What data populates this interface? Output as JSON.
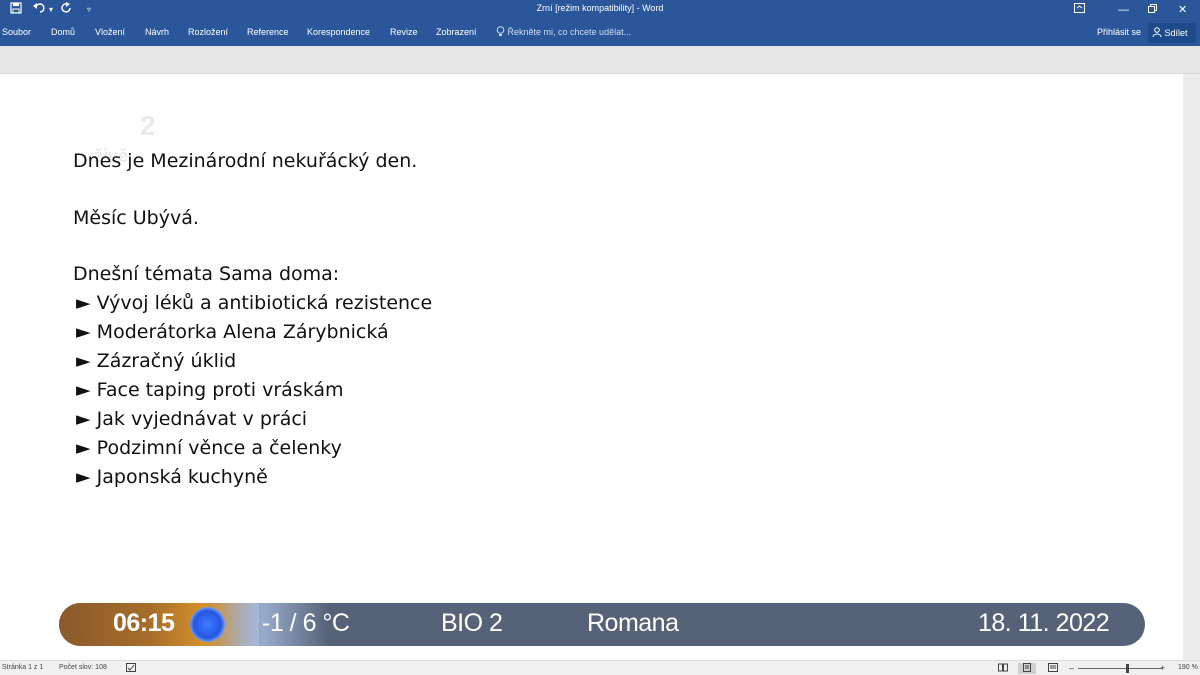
{
  "titlebar": {
    "title": "Zrní [režim kompatibility] - Word",
    "icons": [
      "save-icon",
      "undo-icon",
      "redo-icon",
      "customize-icon"
    ],
    "window_controls": [
      "ribbon-display-icon",
      "minimize-icon",
      "restore-icon",
      "close-icon"
    ]
  },
  "ribbon": {
    "tabs": [
      "Soubor",
      "Domů",
      "Vložení",
      "Návrh",
      "Rozložení",
      "Reference",
      "Korespondence",
      "Revize",
      "Zobrazení"
    ],
    "tell_me": "Řekněte mi, co chcete udělat...",
    "sign_in": "Přihlásit se",
    "share": "Sdílet"
  },
  "logo": {
    "number": "2",
    "label": "živě"
  },
  "document": {
    "line1": "Dnes je Mezinárodní nekuřácký den.",
    "line2": "Měsíc Ubývá.",
    "heading": "Dnešní témata Sama doma:",
    "bullet_char": "►",
    "items": [
      "Vývoj léků a antibiotická rezistence",
      "Moderátorka Alena Zárybnická",
      "Zázračný úklid",
      "Face taping proti vráskám",
      "Jak vyjednávat v práci",
      "Podzimní věnce a čelenky",
      "Japonská kuchyně"
    ]
  },
  "ticker": {
    "time": "06:15",
    "temperature": "-1 / 6 °C",
    "channel": "BIO 2",
    "nameday": "Romana",
    "date": "18. 11. 2022",
    "weather_icon": "weather-icon"
  },
  "statusbar": {
    "page": "Stránka 1 z 1",
    "words": "Počet slov: 108",
    "zoom": "190 %"
  }
}
